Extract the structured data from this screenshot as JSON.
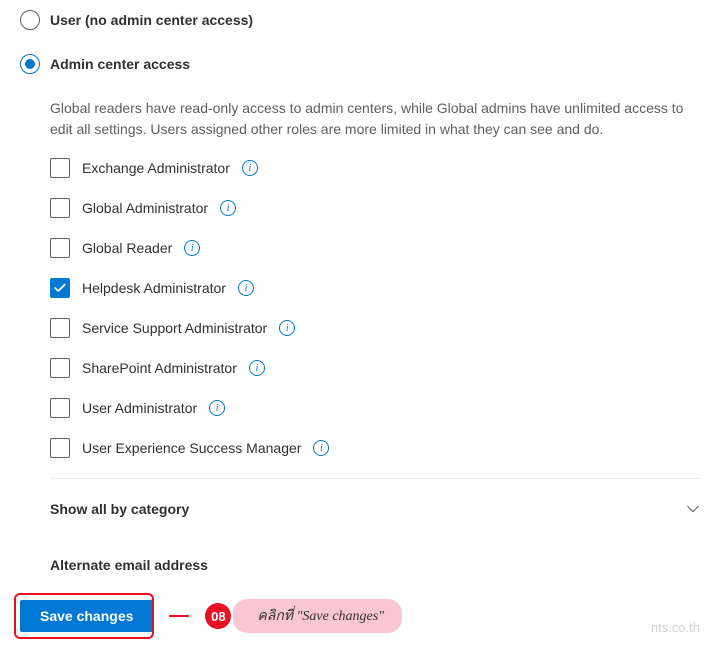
{
  "radios": {
    "user_no_admin": "User (no admin center access)",
    "admin_center": "Admin center access"
  },
  "admin": {
    "description": "Global readers have read-only access to admin centers, while Global admins have unlimited access to edit all settings. Users assigned other roles are more limited in what they can see and do.",
    "roles": [
      {
        "label": "Exchange Administrator",
        "checked": false
      },
      {
        "label": "Global Administrator",
        "checked": false
      },
      {
        "label": "Global Reader",
        "checked": false
      },
      {
        "label": "Helpdesk Administrator",
        "checked": true
      },
      {
        "label": "Service Support Administrator",
        "checked": false
      },
      {
        "label": "SharePoint Administrator",
        "checked": false
      },
      {
        "label": "User Administrator",
        "checked": false
      },
      {
        "label": "User Experience Success Manager",
        "checked": false
      }
    ],
    "show_all_label": "Show all by category"
  },
  "alt_email_label": "Alternate email address",
  "buttons": {
    "save": "Save changes"
  },
  "annotation": {
    "step": "08",
    "text": "คลิกที่ \"Save changes\""
  },
  "watermark": "nts.co.th"
}
